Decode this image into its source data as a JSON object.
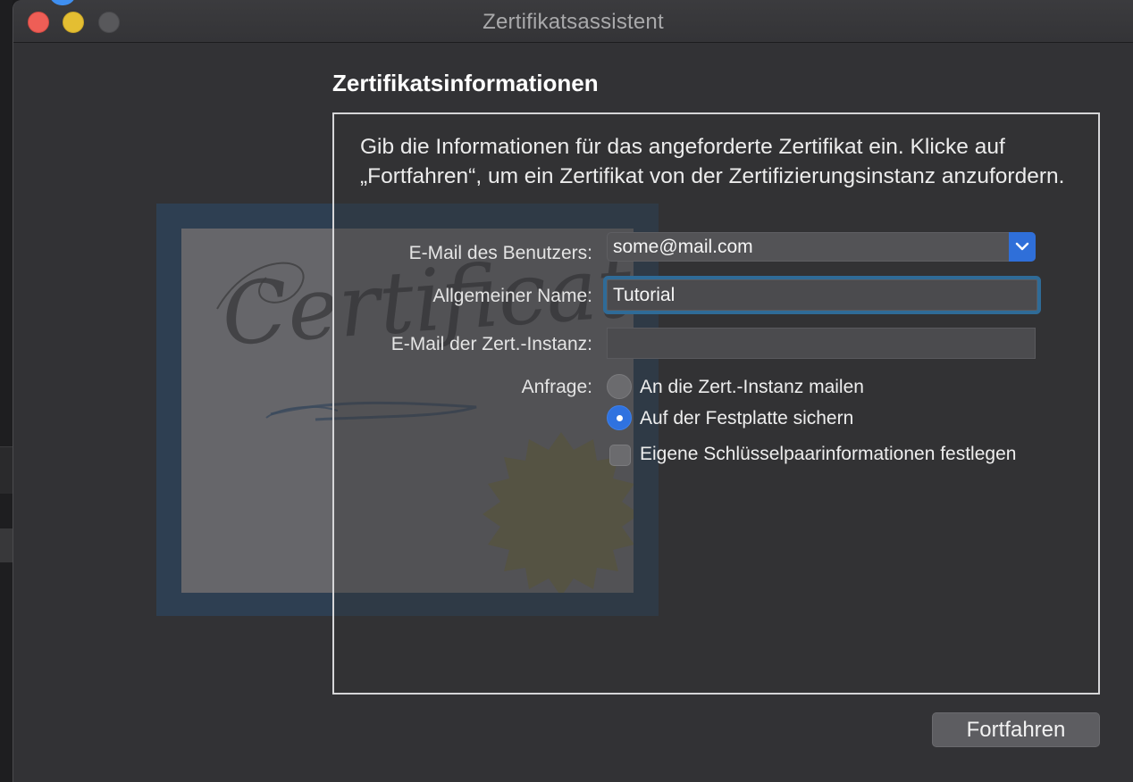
{
  "window": {
    "title": "Zertifikatsassistent",
    "accent_color": "#2f72e0"
  },
  "form": {
    "heading": "Zertifikatsinformationen",
    "intro": "Gib die Informationen für das angeforderte Zertifikat ein. Klicke auf „Fortfahren“, um ein Zertifikat von der Zertifizierungsinstanz anzufordern.",
    "user_email_label": "E-Mail des Benutzers:",
    "user_email_value": "some@mail.com",
    "common_name_label": "Allgemeiner Name:",
    "common_name_value": "Tutorial",
    "ca_email_label": "E-Mail der Zert.-Instanz:",
    "ca_email_value": "",
    "request_label": "Anfrage:",
    "options": [
      {
        "label": "An die Zert.-Instanz mailen",
        "selected": false
      },
      {
        "label": "Auf der Festplatte sichern",
        "selected": true
      }
    ],
    "keypair_checkbox_label": "Eigene Schlüsselpaarinformationen festlegen",
    "keypair_checked": false,
    "illustration_word": "Certificate"
  },
  "buttons": {
    "continue_label": "Fortfahren"
  },
  "icons": {
    "popup": "chevron-down-icon",
    "close": "close-icon",
    "minimize": "minimize-icon",
    "zoom": "zoom-icon"
  }
}
